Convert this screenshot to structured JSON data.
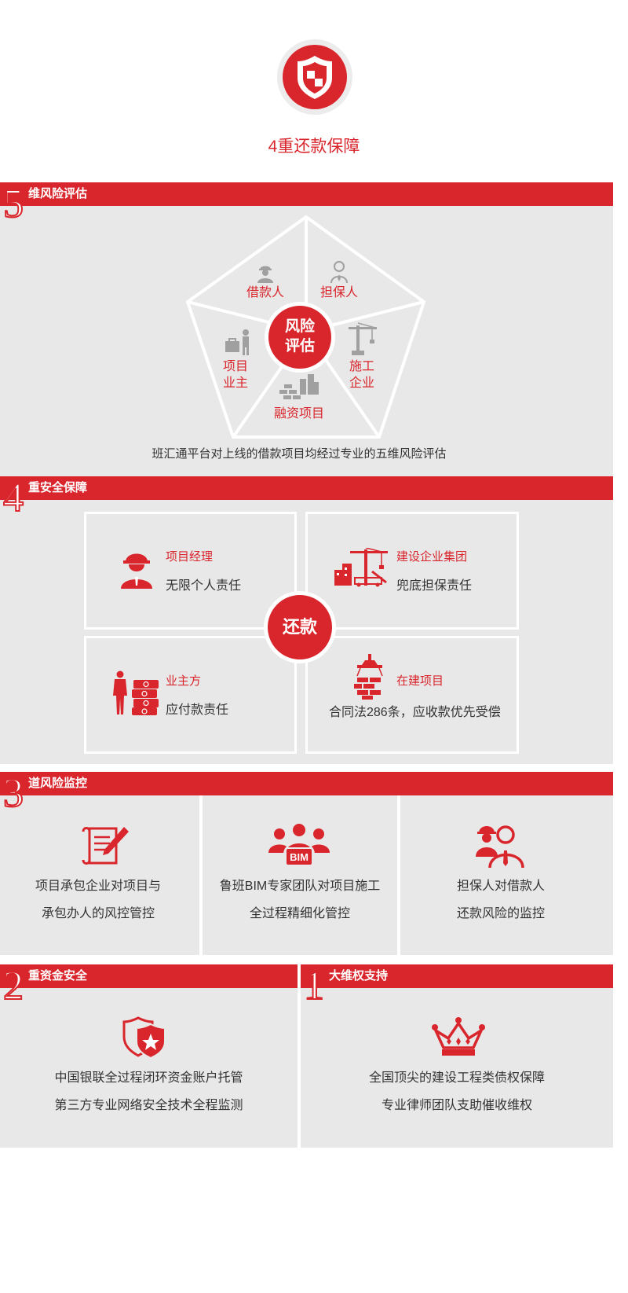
{
  "header": {
    "title": "4重还款保障"
  },
  "sections": {
    "risk_eval": {
      "number": "5",
      "label": "维风险评估",
      "center": "风险\n评估",
      "center_line1": "风险",
      "center_line2": "评估",
      "items": {
        "borrower": "借款人",
        "guarantor": "担保人",
        "owner_line1": "项目",
        "owner_line2": "业主",
        "contractor_line1": "施工",
        "contractor_line2": "企业",
        "project": "融资项目"
      },
      "caption": "班汇通平台对上线的借款项目均经过专业的五维风险评估"
    },
    "security": {
      "number": "4",
      "label": "重安全保障",
      "center": "还款",
      "cards": [
        {
          "title": "项目经理",
          "desc": "无限个人责任"
        },
        {
          "title": "建设企业集团",
          "desc": "兜底担保责任"
        },
        {
          "title": "业主方",
          "desc": "应付款责任"
        },
        {
          "title": "在建项目",
          "desc": "合同法286条，应收款优先受偿"
        }
      ]
    },
    "monitor": {
      "number": "3",
      "label": "道风险监控",
      "cols": [
        {
          "line1": "项目承包企业对项目与",
          "line2": "承包办人的风控管控",
          "icon": "contract-pen-icon"
        },
        {
          "line1": "鲁班BIM专家团队对项目施工",
          "line2": "全过程精细化管控",
          "icon": "bim-team-icon",
          "badge": "BIM"
        },
        {
          "line1": "担保人对借款人",
          "line2": "还款风险的监控",
          "icon": "guarantor-people-icon"
        }
      ]
    },
    "funds": {
      "number": "2",
      "label": "重资金安全",
      "line1": "中国银联全过程闭环资金账户托管",
      "line2": "第三方专业网络安全技术全程监测"
    },
    "rights": {
      "number": "1",
      "label": "大维权支持",
      "line1": "全国顶尖的建设工程类债权保障",
      "line2": "专业律师团队支助催收维权"
    }
  },
  "colors": {
    "accent": "#d9262c",
    "panel": "#e8e8e9",
    "icon_gray": "#a0a0a0"
  }
}
